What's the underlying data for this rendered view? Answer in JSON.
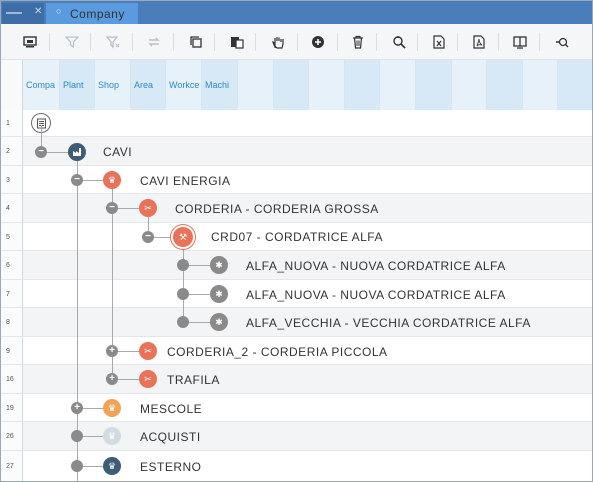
{
  "tabs": {
    "inactive_close": "✕",
    "active_label": "Company",
    "active_icon": "company-circle-icon"
  },
  "toolbar": {
    "icons": [
      "screen-icon",
      "filter-icon",
      "filter-off-icon",
      "swap-icon",
      "copy-icon",
      "paste-icon",
      "hand-icon",
      "add-icon",
      "delete-icon",
      "search-icon",
      "excel-icon",
      "pdf-icon",
      "tablet-icon",
      "zoom-icon"
    ]
  },
  "columns": [
    "Compa",
    "Plant",
    "Shop",
    "Area",
    "Workce",
    "Machi"
  ],
  "colors": {
    "tab_bar": "#4a7ebb",
    "header_text": "#2f88c6",
    "node_dark": "#3e5c76",
    "node_orange": "#e8735a",
    "node_amber": "#f0a45a",
    "node_light": "#d3dbe2",
    "node_gray": "#8a8a8a"
  },
  "rows": [
    {
      "num": "1",
      "label": ""
    },
    {
      "num": "2",
      "label": "CAVI"
    },
    {
      "num": "3",
      "label": "CAVI ENERGIA"
    },
    {
      "num": "4",
      "label": "CORDERIA - CORDERIA GROSSA"
    },
    {
      "num": "5",
      "label": "CRD07 - CORDATRICE ALFA"
    },
    {
      "num": "6",
      "label": "ALFA_NUOVA - NUOVA CORDATRICE ALFA"
    },
    {
      "num": "7",
      "label": "ALFA_NUOVA - NUOVA CORDATRICE ALFA"
    },
    {
      "num": "8",
      "label": "ALFA_VECCHIA - VECCHIA CORDATRICE ALFA"
    },
    {
      "num": "9",
      "label": "CORDERIA_2 - CORDERIA PICCOLA"
    },
    {
      "num": "16",
      "label": "TRAFILA"
    },
    {
      "num": "19",
      "label": "MESCOLE"
    },
    {
      "num": "26",
      "label": "ACQUISTI"
    },
    {
      "num": "27",
      "label": "ESTERNO"
    }
  ],
  "toggles": {
    "minus": "−",
    "plus": "+"
  }
}
